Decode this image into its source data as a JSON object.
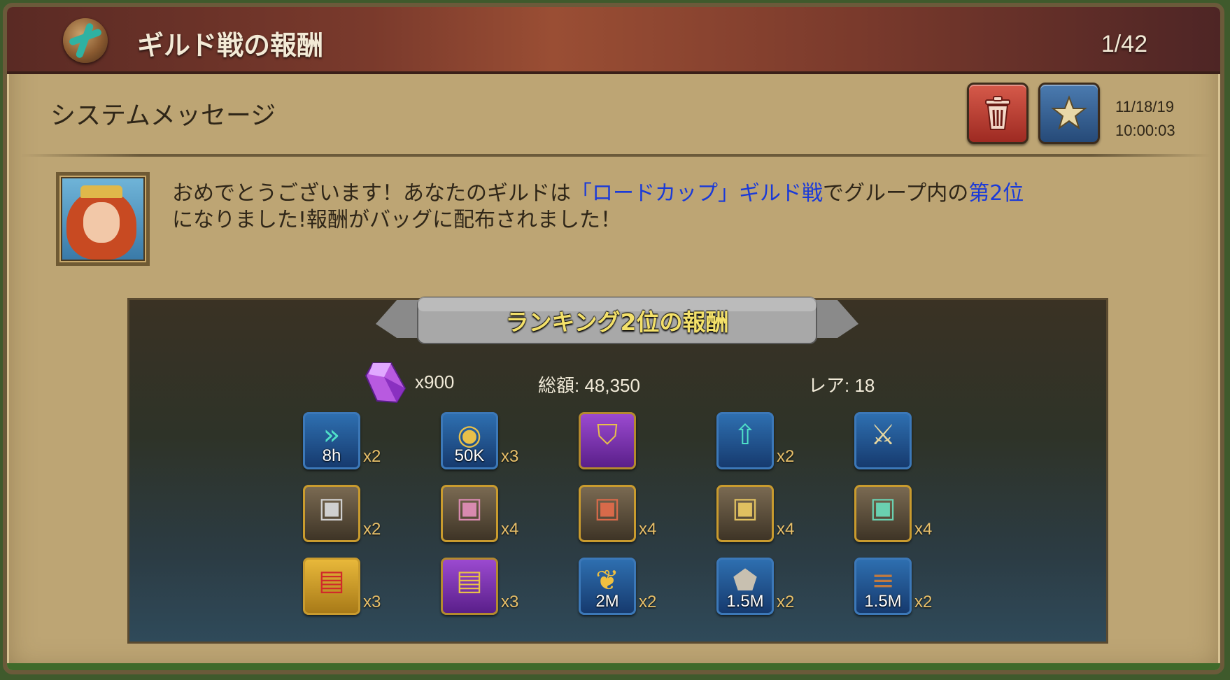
{
  "header": {
    "title": "ギルド戦の報酬",
    "page_count": "1/42"
  },
  "mail": {
    "sender": "システムメッセージ",
    "date": "11/18/19",
    "time": "10:00:03",
    "message_parts": [
      {
        "text": "おめでとうございます！あなたのギルドは",
        "highlight": false
      },
      {
        "text": "「ロードカップ」ギルド戦",
        "highlight": true
      },
      {
        "text": "でグループ内の",
        "highlight": false
      },
      {
        "text": "第2位",
        "highlight": true
      },
      {
        "text": "になりました!報酬がバッグに配布されました！",
        "highlight": false
      }
    ]
  },
  "rewards": {
    "title": "ランキング2位の報酬",
    "gems_qty": "x900",
    "total_label": "総額: 48,350",
    "rare_label": "レア: 18",
    "rows": [
      [
        {
          "name": "speedup-8h",
          "icon": "speedup-arrows-icon",
          "label": "8h",
          "qty": "x2",
          "style": "blue",
          "glyph": "»",
          "color": "#4fe0c8"
        },
        {
          "name": "gold-50k",
          "icon": "gold-coins-icon",
          "label": "50K",
          "qty": "x3",
          "style": "blue",
          "glyph": "◉",
          "color": "#e8c04a"
        },
        {
          "name": "guild-chest",
          "icon": "purple-chest-icon",
          "label": "",
          "qty": "",
          "style": "purple",
          "glyph": "⛉",
          "color": "#e8c04a"
        },
        {
          "name": "armor-upgrade",
          "icon": "armor-upgrade-icon",
          "label": "",
          "qty": "x2",
          "style": "blue",
          "glyph": "⇧",
          "color": "#4fe0c8"
        },
        {
          "name": "weapon-upgrade",
          "icon": "sword-upgrade-icon",
          "label": "",
          "qty": "",
          "style": "blue",
          "glyph": "⚔",
          "color": "#e8d8a0"
        }
      ],
      [
        {
          "name": "material-chest-1",
          "icon": "steel-chest-icon",
          "label": "",
          "qty": "x2",
          "style": "gold",
          "glyph": "▣",
          "color": "#d0d0d0"
        },
        {
          "name": "material-chest-2",
          "icon": "pink-chest-icon",
          "label": "",
          "qty": "x4",
          "style": "gold",
          "glyph": "▣",
          "color": "#d88ab0"
        },
        {
          "name": "material-chest-3",
          "icon": "red-chest-icon",
          "label": "",
          "qty": "x4",
          "style": "gold",
          "glyph": "▣",
          "color": "#d86a4a"
        },
        {
          "name": "material-chest-4",
          "icon": "spiked-chest-icon",
          "label": "",
          "qty": "x4",
          "style": "gold",
          "glyph": "▣",
          "color": "#e0c060"
        },
        {
          "name": "material-chest-5",
          "icon": "green-chest-icon",
          "label": "",
          "qty": "x4",
          "style": "gold",
          "glyph": "▣",
          "color": "#6ad0b0"
        }
      ],
      [
        {
          "name": "red-gold-chest",
          "icon": "red-treasure-chest-icon",
          "label": "",
          "qty": "x3",
          "style": "yellow",
          "glyph": "▤",
          "color": "#d02a2a"
        },
        {
          "name": "purple-gold-chest",
          "icon": "purple-treasure-chest-icon",
          "label": "",
          "qty": "x3",
          "style": "purple",
          "glyph": "▤",
          "color": "#e8c04a"
        },
        {
          "name": "food-2m",
          "icon": "wheat-icon",
          "label": "2M",
          "qty": "x2",
          "style": "blue",
          "glyph": "❦",
          "color": "#f0c040"
        },
        {
          "name": "stone-1-5m",
          "icon": "stone-icon",
          "label": "1.5M",
          "qty": "x2",
          "style": "blue",
          "glyph": "⬟",
          "color": "#c8c0b0"
        },
        {
          "name": "wood-1-5m",
          "icon": "wood-logs-icon",
          "label": "1.5M",
          "qty": "x2",
          "style": "blue",
          "glyph": "≡",
          "color": "#c07a40"
        }
      ]
    ]
  },
  "colors": {
    "highlight": "#1a3ad8",
    "panel_bg": "#bda574",
    "title_bar": "#7a3a2c",
    "ribbon_text": "#f3e06a"
  }
}
